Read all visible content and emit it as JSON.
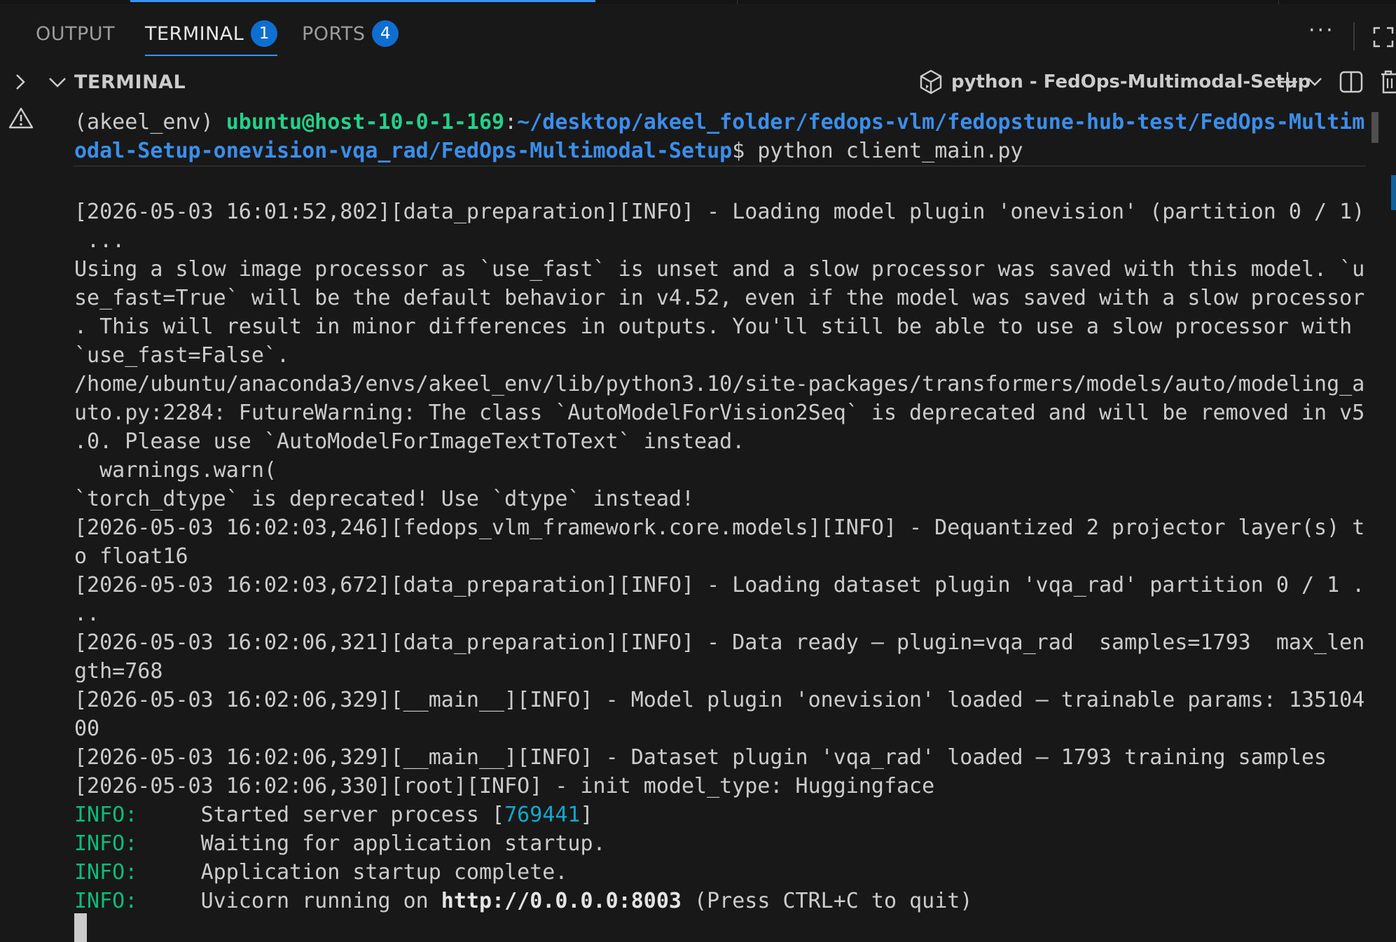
{
  "tabs": [
    {
      "label": "OUTPUT",
      "badge": null,
      "active": false
    },
    {
      "label": "TERMINAL",
      "badge": "1",
      "active": true
    },
    {
      "label": "PORTS",
      "badge": "4",
      "active": false
    }
  ],
  "tab_actions": {
    "more": "···"
  },
  "terminal_header": {
    "section_title": "TERMINAL",
    "terminal_name": "python - FedOps-Multimodal-Setup"
  },
  "prompt": {
    "env": "(akeel_env) ",
    "user_host": "ubuntu@host-10-0-1-169",
    "colon": ":",
    "path_line1": "~/desktop/akeel_folder/fedops-vlm/fedopstune-hub-test/FedOps-Multim",
    "path_line2": "odal-Setup-onevision-vqa_rad/FedOps-Multimodal-Setup",
    "dollar": "$ ",
    "command": "python client_main.py"
  },
  "output_lines": [
    "[2026-05-03 16:01:52,802][data_preparation][INFO] - Loading model plugin 'onevision' (partition 0 / 1)",
    " ...",
    "Using a slow image processor as `use_fast` is unset and a slow processor was saved with this model. `u",
    "se_fast=True` will be the default behavior in v4.52, even if the model was saved with a slow processor",
    ". This will result in minor differences in outputs. You'll still be able to use a slow processor with",
    "`use_fast=False`.",
    "/home/ubuntu/anaconda3/envs/akeel_env/lib/python3.10/site-packages/transformers/models/auto/modeling_a",
    "uto.py:2284: FutureWarning: The class `AutoModelForVision2Seq` is deprecated and will be removed in v5",
    ".0. Please use `AutoModelForImageTextToText` instead.",
    "  warnings.warn(",
    "`torch_dtype` is deprecated! Use `dtype` instead!",
    "[2026-05-03 16:02:03,246][fedops_vlm_framework.core.models][INFO] - Dequantized 2 projector layer(s) t",
    "o float16",
    "[2026-05-03 16:02:03,672][data_preparation][INFO] - Loading dataset plugin 'vqa_rad' partition 0 / 1 .",
    "..",
    "[2026-05-03 16:02:06,321][data_preparation][INFO] - Data ready — plugin=vqa_rad  samples=1793  max_len",
    "gth=768",
    "[2026-05-03 16:02:06,329][__main__][INFO] - Model plugin 'onevision' loaded — trainable params: 135104",
    "00",
    "[2026-05-03 16:02:06,329][__main__][INFO] - Dataset plugin 'vqa_rad' loaded — 1793 training samples",
    "[2026-05-03 16:02:06,330][root][INFO] - init model_type: Huggingface"
  ],
  "uvicorn": {
    "prefix": "INFO:",
    "line1_text": "     Started server process [",
    "pid": "769441",
    "line1_end": "]",
    "line2": "     Waiting for application startup.",
    "line3": "     Application startup complete.",
    "line4_pre": "     Uvicorn running on ",
    "url": "http://0.0.0.0:8003",
    "line4_post": " (Press CTRL+C to quit)"
  },
  "colors": {
    "accent": "#3794ff",
    "badge": "#0e6fd1",
    "user_host": "#23d18b",
    "path": "#3b8eea",
    "info": "#0dbc79"
  }
}
